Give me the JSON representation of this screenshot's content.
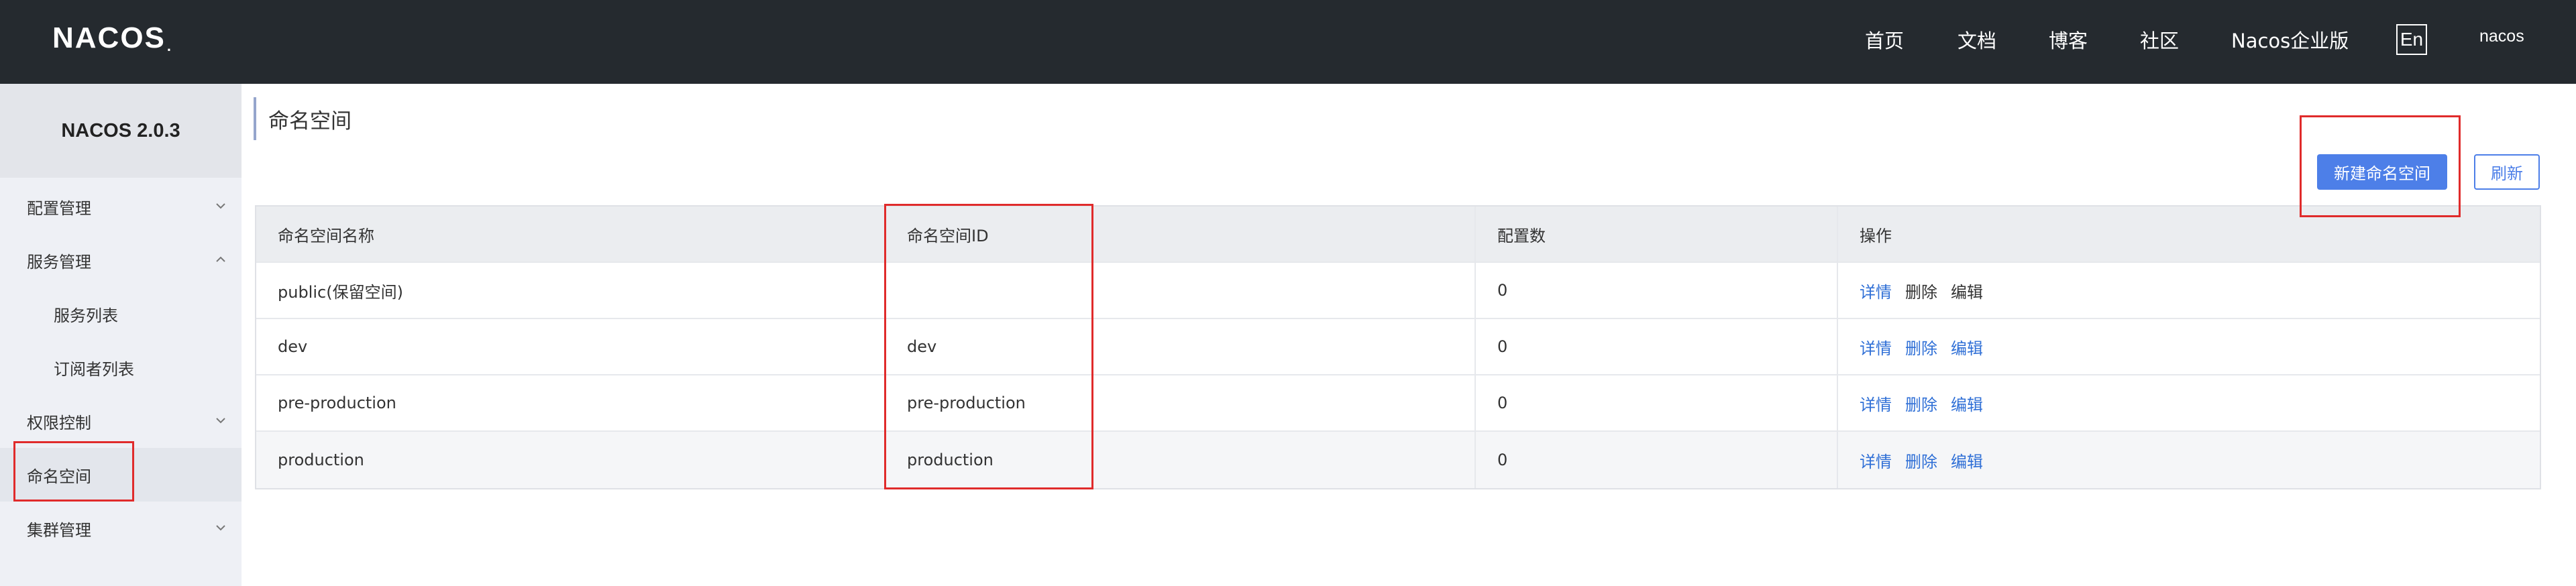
{
  "header": {
    "logo_text": "NACOS",
    "logo_dot": ".",
    "nav": [
      {
        "label": "首页"
      },
      {
        "label": "文档"
      },
      {
        "label": "博客"
      },
      {
        "label": "社区"
      },
      {
        "label": "Nacos企业版"
      }
    ],
    "lang_button": "En",
    "user": "nacos"
  },
  "sidebar": {
    "title": "NACOS 2.0.3",
    "items": [
      {
        "label": "配置管理",
        "icon": "chevron-down-icon"
      },
      {
        "label": "服务管理",
        "icon": "chevron-up-icon"
      },
      {
        "label": "服务列表"
      },
      {
        "label": "订阅者列表"
      },
      {
        "label": "权限控制",
        "icon": "chevron-down-icon"
      },
      {
        "label": "命名空间"
      },
      {
        "label": "集群管理",
        "icon": "chevron-down-icon"
      }
    ]
  },
  "main": {
    "title": "命名空间",
    "new_button": "新建命名空间",
    "refresh_button": "刷新",
    "table": {
      "headers": [
        "命名空间名称",
        "命名空间ID",
        "配置数",
        "操作"
      ],
      "rows": [
        {
          "name": "public(保留空间)",
          "id": "",
          "count": "0",
          "actions": [
            "详情",
            "删除",
            "编辑"
          ]
        },
        {
          "name": "dev",
          "id": "dev",
          "count": "0",
          "actions": [
            "详情",
            "删除",
            "编辑"
          ]
        },
        {
          "name": "pre-production",
          "id": "pre-production",
          "count": "0",
          "actions": [
            "详情",
            "删除",
            "编辑"
          ]
        },
        {
          "name": "production",
          "id": "production",
          "count": "0",
          "actions": [
            "详情",
            "删除",
            "编辑"
          ]
        }
      ]
    }
  },
  "colors": {
    "header_bg": "#252a2f",
    "sidebar_bg": "#eef0f5",
    "primary": "#4d7fe8",
    "link": "#2f6fd6",
    "annotation": "#e02b2b"
  }
}
